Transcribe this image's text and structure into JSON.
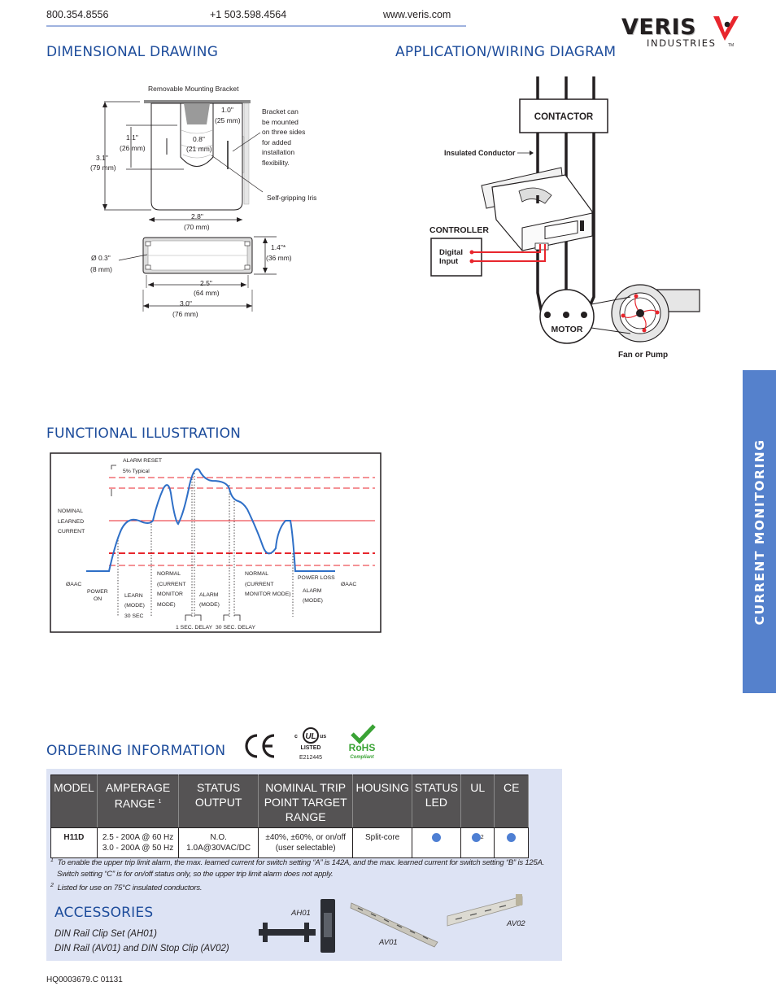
{
  "header": {
    "phone_tollfree": "800.354.8556",
    "phone_intl": "+1 503.598.4564",
    "website": "www.veris.com",
    "logo": {
      "brand": "VERIS",
      "subtitle": "INDUSTRIES",
      "tm": "TM",
      "accent_color": "#e8262d"
    }
  },
  "side_tab": {
    "label": "CURRENT MONITORING",
    "color": "#5581cc"
  },
  "sections": {
    "dimensional_drawing": "DIMENSIONAL DRAWING",
    "wiring_diagram": "APPLICATION/WIRING DIAGRAM",
    "functional_illustration": "FUNCTIONAL ILLUSTRATION",
    "ordering_information": "ORDERING INFORMATION",
    "accessories": "ACCESSORIES"
  },
  "dimensional_drawing": {
    "bracket_label": "Removable Mounting Bracket",
    "bracket_note": [
      "Bracket can",
      "be mounted",
      "on three sides",
      "for added",
      "installation",
      "flexibility."
    ],
    "iris_label": "Self-gripping Iris",
    "dims": {
      "height": [
        "3.1\"",
        "(79 mm)"
      ],
      "opening_height": [
        "1.1\"",
        "(26 mm)"
      ],
      "top_width": [
        "1.0\"",
        "(25 mm)"
      ],
      "opening_width": [
        "0.8\"",
        "(21 mm)"
      ],
      "width": [
        "2.8\"",
        "(70 mm)"
      ],
      "hole": [
        "Ø  0.3\"",
        "(8 mm)"
      ],
      "depth": [
        "1.4\"*",
        "(36 mm)"
      ],
      "hole_spacing": [
        "2.5\"",
        "(64 mm)"
      ],
      "overall_width": [
        "3.0\"",
        "(76 mm)"
      ]
    }
  },
  "wiring_diagram": {
    "contactor": "CONTACTOR",
    "insulated_conductor": "Insulated Conductor",
    "controller": "CONTROLLER",
    "digital_input": [
      "Digital",
      "Input"
    ],
    "motor": "MOTOR",
    "fan_or_pump": "Fan or Pump",
    "wire_color": "#e8262d"
  },
  "functional_illustration": {
    "alarm_reset": "ALARM RESET",
    "five_percent": "5% Typical",
    "nominal": [
      "NOMINAL",
      "LEARNED",
      "CURRENT"
    ],
    "zero_left": "ØAAC",
    "zero_right": "ØAAC",
    "power_on": [
      "POWER",
      "ON"
    ],
    "learn": [
      "LEARN",
      "(MODE)",
      "30 SEC"
    ],
    "normal1": [
      "NORMAL",
      "(CURRENT",
      "MONITOR",
      "MODE)"
    ],
    "alarm1": [
      "ALARM",
      "(MODE)"
    ],
    "normal2": [
      "NORMAL",
      "(CURRENT",
      "MONITOR MODE)"
    ],
    "power_loss": "POWER LOSS",
    "alarm2": [
      "ALARM",
      "(MODE)"
    ],
    "delay1": "1 SEC. DELAY",
    "delay2": "30 SEC. DELAY",
    "line_color": "#e8262d",
    "curve_color": "#2e6fc7"
  },
  "certifications": {
    "ce": "CE",
    "ul_c": "c",
    "ul_us": "us",
    "ul_listed": "LISTED",
    "ul_file": "E212445",
    "rohs": "RoHS",
    "rohs_sub": "Compliant",
    "rohs_color": "#3aa335"
  },
  "ordering": {
    "columns": [
      "MODEL",
      "AMPERAGE RANGE",
      "STATUS OUTPUT",
      "NOMINAL TRIP POINT TARGET RANGE",
      "HOUSING",
      "STATUS LED",
      "UL",
      "CE"
    ],
    "amperage_note": "1",
    "rows": [
      {
        "model": "H11D",
        "amperage": [
          "2.5 - 200A @ 60 Hz",
          "3.0 - 200A @ 50 Hz"
        ],
        "status_output": "N.O. 1.0A@30VAC/DC",
        "trip_range": [
          "±40%, ±60%, or on/off",
          "(user selectable)"
        ],
        "housing": "Split-core",
        "status_led": true,
        "ul": true,
        "ul_note": "2",
        "ce": true
      }
    ],
    "footnotes": [
      {
        "mark": "1",
        "text": "To enable the upper trip limit alarm, the max. learned current for switch setting “A” is 142A, and the max. learned current for switch setting “B” is 125A."
      },
      {
        "mark": "",
        "text": "Switch setting “C” is for on/off status only, so the upper trip limit alarm does not apply."
      },
      {
        "mark": "2",
        "text": "Listed for use on 75°C insulated conductors."
      }
    ]
  },
  "accessories": {
    "items": [
      "DIN Rail Clip Set (AH01)",
      "DIN Rail (AV01) and DIN Stop Clip (AV02)"
    ],
    "image_labels": [
      "AH01",
      "AV01",
      "AV02"
    ]
  },
  "footer": {
    "doc_code": "HQ0003679.C   01131"
  }
}
